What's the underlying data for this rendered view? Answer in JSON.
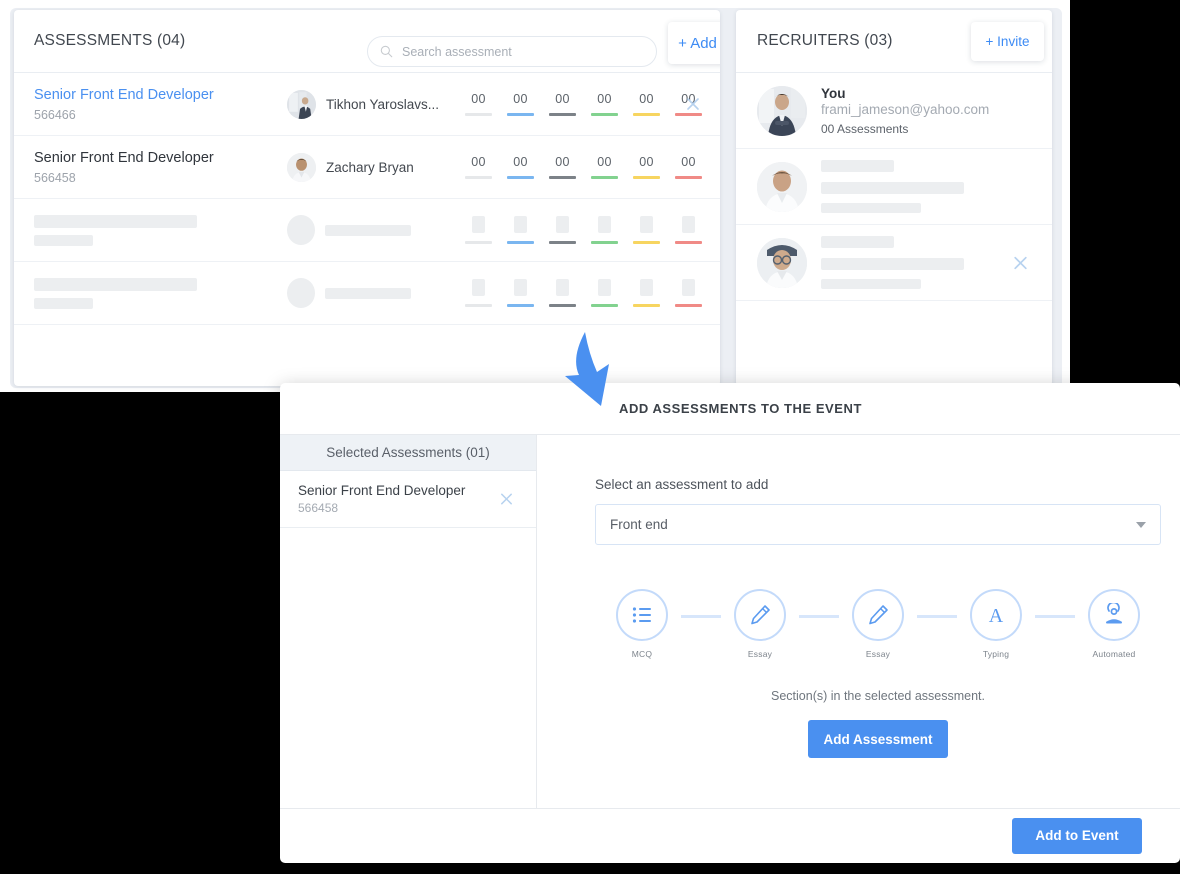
{
  "assessments_panel": {
    "title": "ASSESSMENTS (04)",
    "search_placeholder": "Search assessment",
    "search_value": "",
    "search_icon": "search-icon",
    "add_label": "+ Add",
    "stat_colors": [
      "#e6e8ea",
      "#7ab6f0",
      "#7c8288",
      "#82d28f",
      "#f7d560",
      "#f08a86"
    ],
    "rows": [
      {
        "title": "Senior Front End Developer",
        "id": "566466",
        "person": "Tikhon Yaroslavs...",
        "stats": [
          "00",
          "00",
          "00",
          "00",
          "00",
          "00"
        ],
        "highlighted": true,
        "skeleton": false
      },
      {
        "title": "Senior Front End Developer",
        "id": "566458",
        "person": "Zachary Bryan",
        "stats": [
          "00",
          "00",
          "00",
          "00",
          "00",
          "00"
        ],
        "highlighted": false,
        "skeleton": false
      },
      {
        "skeleton": true
      },
      {
        "skeleton": true
      }
    ]
  },
  "recruiters_panel": {
    "title": "RECRUITERS (03)",
    "invite_label": "+ Invite",
    "rows": [
      {
        "name": "You",
        "email": "frami_jameson@yahoo.com",
        "count": "00 Assessments",
        "skeleton": false,
        "has_remove": false
      },
      {
        "skeleton": true,
        "has_remove": false
      },
      {
        "skeleton": true,
        "has_remove": true
      }
    ]
  },
  "modal": {
    "title": "ADD ASSESSMENTS TO THE EVENT",
    "sidebar": {
      "header": "Selected Assessments (01)",
      "items": [
        {
          "title": "Senior Front End Developer",
          "id": "566458"
        }
      ]
    },
    "select_label": "Select an assessment to add",
    "select_value": "Front end",
    "steps": [
      {
        "label": "MCQ",
        "icon": "list-icon"
      },
      {
        "label": "Essay",
        "icon": "pen-icon"
      },
      {
        "label": "Essay",
        "icon": "pen-icon"
      },
      {
        "label": "Typing",
        "icon": "letter-a-icon"
      },
      {
        "label": "Automated",
        "icon": "person-icon"
      }
    ],
    "section_note": "Section(s) in the selected assessment.",
    "add_assessment_label": "Add Assessment",
    "add_to_event_label": "Add to Event"
  },
  "theme": {
    "accent": "#4a90f0",
    "link": "#4a90f0",
    "step_border": "#c3dafa",
    "close_icon": "#b7d2ef"
  }
}
